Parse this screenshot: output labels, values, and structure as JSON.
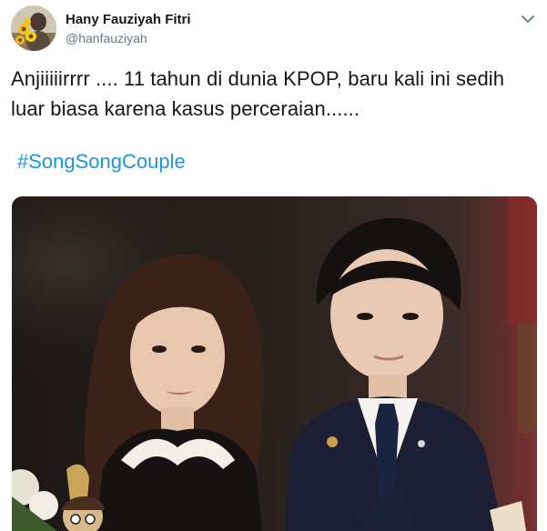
{
  "tweet": {
    "author": {
      "display_name": "Hany Fauziyah Fitri",
      "handle": "@hanfauziyah"
    },
    "text_line_1": "Anjiiiiirrrr .... 11 tahun di dunia KPOP, baru kali ini sedih",
    "text_line_2": "luar biasa karena kasus perceraian......",
    "hashtag": "#SongSongCouple"
  },
  "colors": {
    "text_primary": "#14171a",
    "text_secondary": "#657786",
    "link": "#1b95e0"
  },
  "icons": {
    "menu": "chevron-down-icon"
  }
}
